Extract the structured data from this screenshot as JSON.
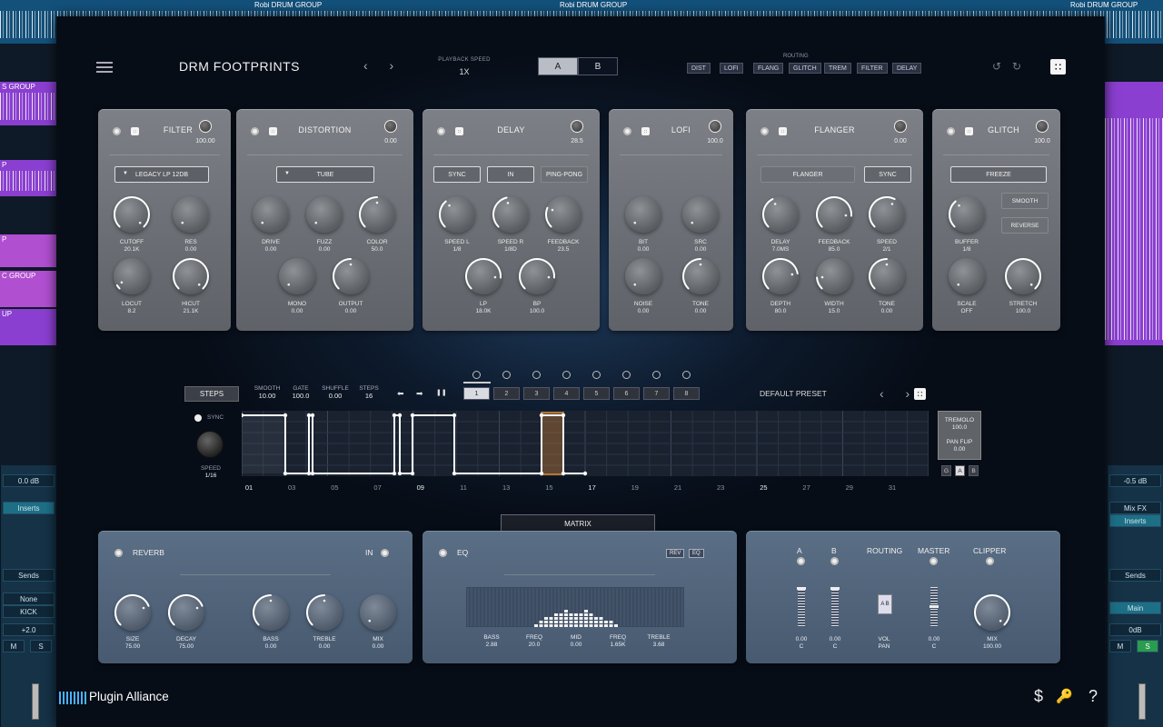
{
  "daw": {
    "group_labels": [
      "Robi DRUM GROUP",
      "Robi DRUM GROUP",
      "Robi DRUM GROUP"
    ],
    "side_labels": [
      "S GROUP",
      "P",
      "P",
      "C GROUP",
      "UP"
    ],
    "left_strip": {
      "db": "0.0 dB",
      "inserts": "Inserts",
      "sends": "Sends",
      "route": "None",
      "channel": "KICK",
      "pan": "+2.0",
      "pan_c": "<C>",
      "m": "M",
      "s": "S"
    },
    "right_strip": {
      "db": "-0.5 dB",
      "mixfx": "Mix FX",
      "inserts": "Inserts",
      "sends": "Sends",
      "channel": "Main",
      "pan": "0dB",
      "pan_c": "<C>",
      "m": "M",
      "s": "S"
    }
  },
  "header": {
    "title": "DRM FOOTPRINTS",
    "playback_label": "PLAYBACK SPEED",
    "playback_value": "1X",
    "a_label": "A",
    "b_label": "B",
    "routing_label": "ROUTING",
    "routing": [
      "DIST",
      "LOFI",
      "FLANG",
      "GLITCH",
      "TREM",
      "FILTER",
      "DELAY"
    ]
  },
  "filter": {
    "title": "FILTER",
    "value": "100.00",
    "mode": "LEGACY LP 12DB",
    "knobs": [
      {
        "label": "CUTOFF",
        "value": "20.1K"
      },
      {
        "label": "RES",
        "value": "0.00"
      },
      {
        "label": "LOCUT",
        "value": "8.2"
      },
      {
        "label": "HICUT",
        "value": "21.1K"
      }
    ]
  },
  "distortion": {
    "title": "DISTORTION",
    "value": "0.00",
    "mode": "TUBE",
    "knobs": [
      {
        "label": "DRIVE",
        "value": "0.00"
      },
      {
        "label": "FUZZ",
        "value": "0.00"
      },
      {
        "label": "COLOR",
        "value": "50.0"
      },
      {
        "label": "MONO",
        "value": "0.00"
      },
      {
        "label": "OUTPUT",
        "value": "0.00"
      }
    ]
  },
  "delay": {
    "title": "DELAY",
    "value": "28.5",
    "buttons": [
      "SYNC",
      "IN",
      "PING-PONG"
    ],
    "knobs": [
      {
        "label": "SPEED L",
        "value": "1/8"
      },
      {
        "label": "SPEED R",
        "value": "1/8D"
      },
      {
        "label": "FEEDBACK",
        "value": "23.5"
      },
      {
        "label": "LP",
        "value": "18.0K"
      },
      {
        "label": "BP",
        "value": "100.0"
      }
    ]
  },
  "lofi": {
    "title": "LOFI",
    "value": "100.0",
    "knobs": [
      {
        "label": "BIT",
        "value": "0.00"
      },
      {
        "label": "SRC",
        "value": "0.00"
      },
      {
        "label": "NOISE",
        "value": "0.00"
      },
      {
        "label": "TONE",
        "value": "0.00"
      }
    ]
  },
  "flanger": {
    "title": "FLANGER",
    "value": "0.00",
    "buttons": [
      "FLANGER",
      "SYNC"
    ],
    "knobs": [
      {
        "label": "DELAY",
        "value": "7.0MS"
      },
      {
        "label": "FEEDBACK",
        "value": "85.0"
      },
      {
        "label": "SPEED",
        "value": "2/1"
      },
      {
        "label": "DEPTH",
        "value": "80.0"
      },
      {
        "label": "WIDTH",
        "value": "15.0"
      },
      {
        "label": "TONE",
        "value": "0.00"
      }
    ]
  },
  "glitch": {
    "title": "GLITCH",
    "value": "100.0",
    "buttons": [
      "FREEZE",
      "SMOOTH",
      "REVERSE"
    ],
    "knobs": [
      {
        "label": "BUFFER",
        "value": "1/8"
      },
      {
        "label": "SCALE",
        "value": "OFF"
      },
      {
        "label": "STRETCH",
        "value": "100.0"
      }
    ]
  },
  "sequencer": {
    "steps_btn": "STEPS",
    "params": [
      {
        "label": "SMOOTH",
        "value": "10.00"
      },
      {
        "label": "GATE",
        "value": "100.0"
      },
      {
        "label": "SHUFFLE",
        "value": "0.00"
      },
      {
        "label": "STEPS",
        "value": "16"
      }
    ],
    "patterns": [
      "1",
      "2",
      "3",
      "4",
      "5",
      "6",
      "7",
      "8"
    ],
    "preset": "DEFAULT PRESET",
    "sync": "SYNC",
    "speed_label": "SPEED",
    "speed_value": "1/16",
    "tremolo_label": "TREMOLO",
    "tremolo_value": "100.0",
    "panflip_label": "PAN FLIP",
    "panflip_value": "0.00",
    "gab": [
      "G",
      "A",
      "B"
    ],
    "step_numbers": [
      "01",
      "03",
      "05",
      "07",
      "09",
      "11",
      "13",
      "15",
      "17",
      "19",
      "21",
      "23",
      "25",
      "27",
      "29",
      "31"
    ],
    "step_values": [
      0.95,
      0,
      0,
      0.95,
      0,
      0,
      0,
      0.95,
      0,
      0.95,
      0,
      0,
      0,
      0,
      0,
      0.95
    ],
    "play_controls": [
      "⬅",
      "➡",
      "❚❚"
    ]
  },
  "matrix": {
    "label": "MATRIX"
  },
  "reverb": {
    "title": "REVERB",
    "in_label": "IN",
    "knobs": [
      {
        "label": "SIZE",
        "value": "75.00"
      },
      {
        "label": "DECAY",
        "value": "75.00"
      },
      {
        "label": "BASS",
        "value": "0.00"
      },
      {
        "label": "TREBLE",
        "value": "0.00"
      },
      {
        "label": "MIX",
        "value": "0.00"
      }
    ]
  },
  "eq": {
    "title": "EQ",
    "rev_btn": "REV",
    "eq_btn": "EQ",
    "params": [
      {
        "label": "BASS",
        "value": "2.88"
      },
      {
        "label": "FREQ",
        "value": "20.0"
      },
      {
        "label": "MID",
        "value": "0.00"
      },
      {
        "label": "FREQ",
        "value": "1.65K"
      },
      {
        "label": "TREBLE",
        "value": "3.68"
      }
    ]
  },
  "master": {
    "a": "A",
    "b": "B",
    "routing": "ROUTING",
    "master": "MASTER",
    "clipper": "CLIPPER",
    "a_vals": {
      "db": "0.00",
      "pan": "C"
    },
    "b_vals": {
      "db": "0.00",
      "pan": "C"
    },
    "vol_label": "VOL",
    "pan_label": "PAN",
    "ab_label": "A B",
    "master_vals": {
      "db": "0.00",
      "pan": "C"
    },
    "mix_label": "MIX",
    "mix_value": "100.00"
  },
  "footer": {
    "brand": "Plugin Alliance",
    "dollar": "$",
    "key": "🔑",
    "help": "?"
  },
  "colors": {
    "accent_orange": "#e08a3a",
    "panel_gray": "#6e7177",
    "panel_blue": "#52657c",
    "seq_line": "#ffffff"
  }
}
